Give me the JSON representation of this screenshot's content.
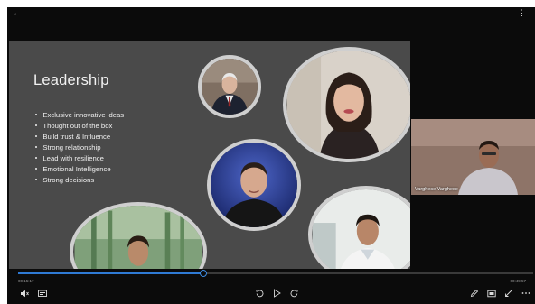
{
  "topbar": {
    "back_icon": "arrow-left-icon",
    "menu_icon": "more-vertical-icon"
  },
  "slide": {
    "title": "Leadership",
    "bullets": [
      "Exclusive innovative ideas",
      "Thought out of the box",
      "Build trust & Influence",
      "Strong relationship",
      "Lead with resilience",
      "Emotional Intelligence",
      "Strong decisions"
    ],
    "colors": {
      "background": "#4a4a4a",
      "photo_border": "#cfcfcf"
    }
  },
  "webcam": {
    "participant_name": "Varghese Varghese"
  },
  "player": {
    "current_time": "00:15:17",
    "total_time": "00:49:57",
    "progress_percent": 36,
    "accent_color": "#2f7ad4",
    "controls_left": [
      "volume-icon",
      "captions-icon"
    ],
    "controls_center": [
      "replay-10-icon",
      "play-icon",
      "forward-10-icon"
    ],
    "controls_right": [
      "pen-icon",
      "rectangle-icon",
      "expand-icon",
      "more-horizontal-icon"
    ]
  }
}
